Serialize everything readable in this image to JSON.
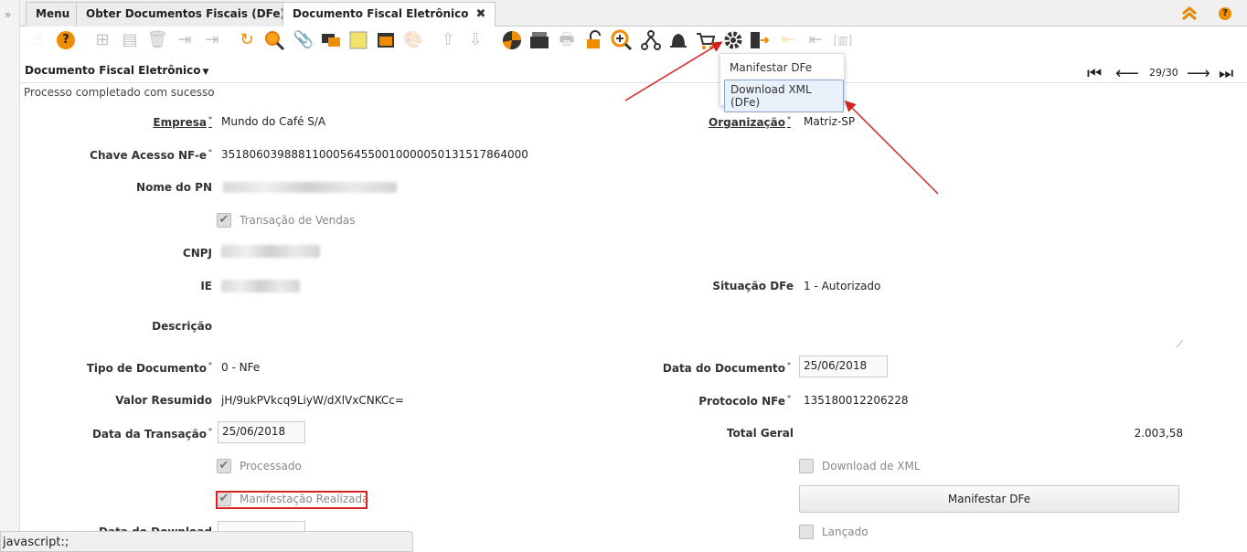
{
  "tabs": [
    {
      "label": "Menu"
    },
    {
      "label": "Obter Documentos Fiscais (DFe)"
    },
    {
      "label": "Documento Fiscal Eletrônico"
    }
  ],
  "window_title": "Documento Fiscal Eletrônico",
  "navigation": {
    "record_position": "29/30"
  },
  "status_message": "Processo completado com sucesso",
  "process_menu": {
    "items": [
      "Manifestar DFe",
      "Download XML (DFe)"
    ]
  },
  "fields": {
    "empresa": {
      "label": "Empresa",
      "value": "Mundo do Café S/A"
    },
    "organizacao": {
      "label": "Organização",
      "value": "Matriz-SP"
    },
    "chave_acesso": {
      "label": "Chave Acesso NF-e",
      "value": "35180603988811000564550010000050131517864000"
    },
    "nome_pn": {
      "label": "Nome do PN"
    },
    "transacao_vendas": {
      "label": "Transação de Vendas",
      "checked": true
    },
    "cnpj": {
      "label": "CNPJ"
    },
    "ie": {
      "label": "IE"
    },
    "situacao_dfe": {
      "label": "Situação DFe",
      "value": "1 - Autorizado"
    },
    "descricao": {
      "label": "Descrição",
      "value": ""
    },
    "tipo_documento": {
      "label": "Tipo de Documento",
      "value": "0 - NFe"
    },
    "data_documento": {
      "label": "Data do Documento",
      "value": "25/06/2018"
    },
    "valor_resumido": {
      "label": "Valor Resumido",
      "value": "jH/9ukPVkcq9LiyW/dXlVxCNKCc="
    },
    "protocolo_nfe": {
      "label": "Protocolo NFe",
      "value": "135180012206228"
    },
    "data_transacao": {
      "label": "Data da Transação",
      "value": "25/06/2018"
    },
    "total_geral": {
      "label": "Total Geral",
      "value": "2.003,58"
    },
    "processado": {
      "label": "Processado",
      "checked": true
    },
    "download_xml": {
      "label": "Download de XML",
      "checked": false
    },
    "manifestacao_realizada": {
      "label": "Manifestação Realizada",
      "checked": true
    },
    "data_download": {
      "label": "Data do Download",
      "value": ""
    },
    "lancado": {
      "label": "Lançado",
      "checked": false
    }
  },
  "buttons": {
    "manifestar": "Manifestar DFe"
  },
  "statusbar_text": "javascript:;",
  "colors": {
    "accent_orange": "#f08c00",
    "annotation_red": "#d22222"
  }
}
